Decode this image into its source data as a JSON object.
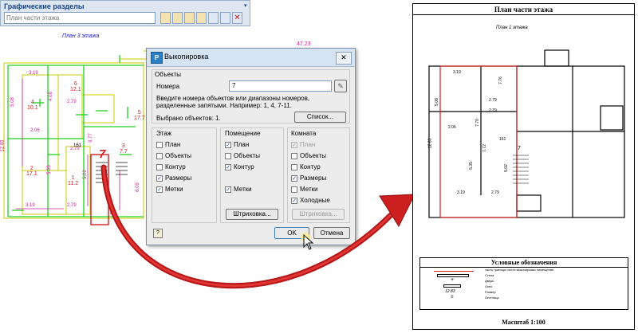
{
  "panel": {
    "title": "Графические разделы",
    "search_placeholder": "План части этажа"
  },
  "cad": {
    "plan_title": "План 3 этажа",
    "dims": [
      "47.23",
      "3.19",
      "5.08",
      "4.08",
      "2.79",
      "2.06",
      "5.35",
      "2.79",
      "5.02",
      "12.83",
      "161",
      "9.77",
      "3.19",
      "2.79",
      "6.09",
      "IV"
    ],
    "room_labels": [
      "6",
      "4",
      "2",
      "1",
      "5",
      "3",
      "7"
    ],
    "room_areas": [
      "12.1",
      "10.1",
      "17.1",
      "11.2",
      "17.7",
      "7.7"
    ]
  },
  "dialog": {
    "title": "Выкопировка",
    "section_objects": "Объекты",
    "number_label": "Номера",
    "number_value": "7",
    "hint": "Введите номера объектов или диапазоны номеров, разделенные запятыми. Например: 1, 4, 7-11.",
    "selected": "Выбрано объектов: 1.",
    "list_button": "Список...",
    "columns": [
      {
        "header": "Этаж",
        "items": [
          {
            "label": "План",
            "checked": false,
            "disabled": false
          },
          {
            "label": "Объекты",
            "checked": false,
            "disabled": false
          },
          {
            "label": "Контур",
            "checked": false,
            "disabled": false
          },
          {
            "label": "Размеры",
            "checked": true,
            "disabled": false
          },
          {
            "label": "Метки",
            "checked": true,
            "disabled": false
          }
        ]
      },
      {
        "header": "Помещение",
        "items": [
          {
            "label": "План",
            "checked": true,
            "disabled": false
          },
          {
            "label": "Объекты",
            "checked": false,
            "disabled": false
          },
          {
            "label": "Контур",
            "checked": true,
            "disabled": false
          },
          {
            "label": "Метки",
            "checked": true,
            "disabled": false
          }
        ]
      },
      {
        "header": "Комната",
        "items": [
          {
            "label": "План",
            "checked": true,
            "disabled": true
          },
          {
            "label": "Объекты",
            "checked": false,
            "disabled": false
          },
          {
            "label": "Контур",
            "checked": false,
            "disabled": false
          },
          {
            "label": "Размеры",
            "checked": true,
            "disabled": false
          },
          {
            "label": "Метки",
            "checked": false,
            "disabled": false
          },
          {
            "label": "Холодные",
            "checked": true,
            "disabled": false
          }
        ]
      }
    ],
    "hatch_button": "Штриховка...",
    "hatch_button_disabled": "Штриховка...",
    "ok_button": "OK",
    "cancel_button": "Отмена"
  },
  "callout_number": "7",
  "sheet": {
    "title": "План части этажа",
    "subtitle": "План 1 этажа",
    "dims": [
      "3.19",
      "7.76",
      "5.08",
      "2.79",
      "2.06",
      "2.79",
      "7.70",
      "161",
      "12.83",
      "5.35",
      "7.72",
      "5.02",
      "3.19",
      "2.79"
    ],
    "marker": "7",
    "legend_title": "Условные обозначения",
    "legend_items": [
      "часть границы листа выкопировки помещения",
      "Стена",
      "Дверь",
      "Окно",
      "Размер",
      "Лестница"
    ],
    "legend_size_sample": "12.83",
    "scale": "Масштаб 1:100"
  },
  "colors": {
    "accent": "#d32020",
    "cad_green": "#1fd01f",
    "cad_yellow": "#c8c800",
    "cad_magenta": "#d0209a",
    "panel_title": "#15428b"
  }
}
